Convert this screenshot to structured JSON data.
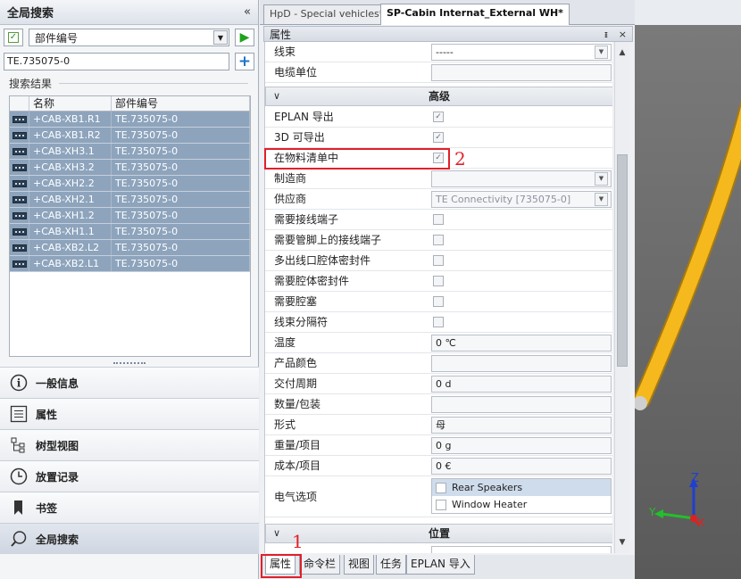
{
  "left": {
    "title": "全局搜索",
    "collapse": "«",
    "filter_field": "部件编号",
    "search_value": "TE.735075-0",
    "results_label": "搜索结果",
    "columns": [
      "名称",
      "部件编号"
    ],
    "rows": [
      {
        "name": "+CAB-XB1.R1",
        "part": "TE.735075-0"
      },
      {
        "name": "+CAB-XB1.R2",
        "part": "TE.735075-0"
      },
      {
        "name": "+CAB-XH3.1",
        "part": "TE.735075-0"
      },
      {
        "name": "+CAB-XH3.2",
        "part": "TE.735075-0"
      },
      {
        "name": "+CAB-XH2.2",
        "part": "TE.735075-0"
      },
      {
        "name": "+CAB-XH2.1",
        "part": "TE.735075-0"
      },
      {
        "name": "+CAB-XH1.2",
        "part": "TE.735075-0"
      },
      {
        "name": "+CAB-XH1.1",
        "part": "TE.735075-0"
      },
      {
        "name": "+CAB-XB2.L2",
        "part": "TE.735075-0"
      },
      {
        "name": "+CAB-XB2.L1",
        "part": "TE.735075-0"
      }
    ],
    "nav": [
      {
        "label": "一般信息",
        "icon": "info-icon"
      },
      {
        "label": "属性",
        "icon": "list-icon"
      },
      {
        "label": "树型视图",
        "icon": "tree-icon"
      },
      {
        "label": "放置记录",
        "icon": "clock-icon"
      },
      {
        "label": "书签",
        "icon": "bookmark-icon"
      },
      {
        "label": "全局搜索",
        "icon": "search-icon"
      }
    ]
  },
  "tabs": {
    "doc1": "HpD - Special vehicles*",
    "doc2": "SP-Cabin Internat_External WH*"
  },
  "props": {
    "title": "属性",
    "pin": "ᵻ",
    "close": "×",
    "wire_harness_label": "线束",
    "wire_harness_value": "-----",
    "cable_unit_label": "电缆单位",
    "section_advanced": "高级",
    "eplan_export": "EPLAN 导出",
    "exportable_3d": "3D 可导出",
    "in_bom": "在物料清单中",
    "manufacturer": "制造商",
    "supplier": "供应商",
    "supplier_value": "TE Connectivity [735075-0]",
    "need_terminal": "需要接线端子",
    "need_pin_terminal": "需要管脚上的接线端子",
    "multi_seal": "多出线口腔体密封件",
    "need_seal": "需要腔体密封件",
    "need_plug": "需要腔塞",
    "separator": "线束分隔符",
    "temperature": "温度",
    "temperature_value": "0 ℃",
    "product_color": "产品颜色",
    "delivery": "交付周期",
    "delivery_value": "0 d",
    "qty_pack": "数量/包装",
    "form": "形式",
    "form_value": "母",
    "weight": "重量/项目",
    "weight_value": "0 g",
    "cost": "成本/项目",
    "cost_value": "0 €",
    "electric_options": "电气选项",
    "opt1": "Rear Speakers",
    "opt2": "Window Heater",
    "section_position": "位置"
  },
  "annotations": {
    "a1": "1",
    "a2": "2"
  },
  "bottom_tabs": [
    "属性",
    "命令栏",
    "视图",
    "任务",
    "EPLAN 导入"
  ],
  "viewport": {
    "axis_z": "Z",
    "axis_y": "Y",
    "axis_x": "X"
  }
}
